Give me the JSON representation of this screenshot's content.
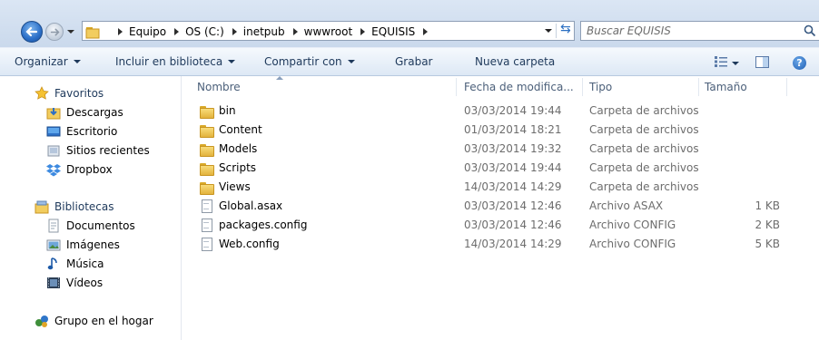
{
  "address_bar": {
    "breadcrumbs": [
      "Equipo",
      "OS (C:)",
      "inetpub",
      "wwwroot",
      "EQUISIS"
    ],
    "search_placeholder": "Buscar EQUISIS"
  },
  "toolbar": {
    "organize": "Organizar",
    "include_library": "Incluir en biblioteca",
    "share": "Compartir con",
    "burn": "Grabar",
    "new_folder": "Nueva carpeta"
  },
  "nav": {
    "favorites_header": "Favoritos",
    "favorites": [
      "Descargas",
      "Escritorio",
      "Sitios recientes",
      "Dropbox"
    ],
    "libraries_header": "Bibliotecas",
    "libraries": [
      "Documentos",
      "Imágenes",
      "Música",
      "Vídeos"
    ],
    "homegroup": "Grupo en el hogar"
  },
  "columns": {
    "name": "Nombre",
    "date": "Fecha de modifica...",
    "type": "Tipo",
    "size": "Tamaño"
  },
  "files": [
    {
      "name": "bin",
      "date": "03/03/2014 19:44",
      "type": "Carpeta de archivos",
      "size": "",
      "icon": "folder-icon"
    },
    {
      "name": "Content",
      "date": "01/03/2014 18:21",
      "type": "Carpeta de archivos",
      "size": "",
      "icon": "folder-icon"
    },
    {
      "name": "Models",
      "date": "03/03/2014 19:32",
      "type": "Carpeta de archivos",
      "size": "",
      "icon": "folder-icon"
    },
    {
      "name": "Scripts",
      "date": "03/03/2014 19:44",
      "type": "Carpeta de archivos",
      "size": "",
      "icon": "folder-icon"
    },
    {
      "name": "Views",
      "date": "14/03/2014 14:29",
      "type": "Carpeta de archivos",
      "size": "",
      "icon": "folder-icon"
    },
    {
      "name": "Global.asax",
      "date": "03/03/2014 12:46",
      "type": "Archivo ASAX",
      "size": "1 KB",
      "icon": "file-icon"
    },
    {
      "name": "packages.config",
      "date": "03/03/2014 12:46",
      "type": "Archivo CONFIG",
      "size": "2 KB",
      "icon": "file-icon"
    },
    {
      "name": "Web.config",
      "date": "14/03/2014 14:29",
      "type": "Archivo CONFIG",
      "size": "5 KB",
      "icon": "file-icon"
    }
  ],
  "colors": {
    "toolbar_text": "#1e395b",
    "secondary_text": "#6d6d6d",
    "folder": "#e3b33d",
    "accent": "#2a6ec7"
  }
}
